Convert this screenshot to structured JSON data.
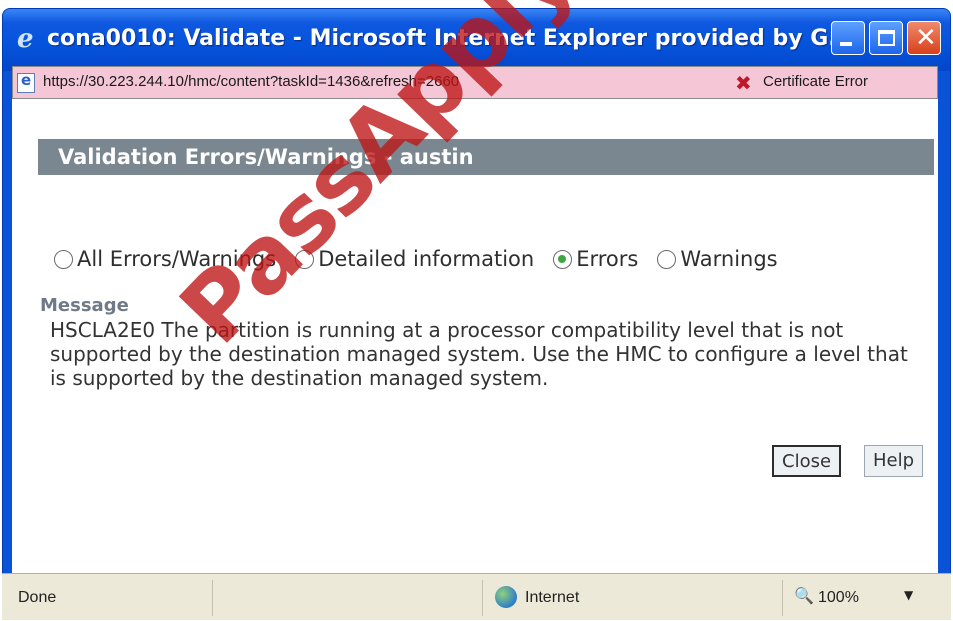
{
  "window": {
    "title": "cona0010: Validate - Microsoft Internet Explorer provided by G...",
    "icon": "ie-icon",
    "controls": [
      "minimize-icon",
      "maximize-icon",
      "close-icon"
    ]
  },
  "address_bar": {
    "url": "https://30.223.244.10/hmc/content?taskId=1436&refresh=2660",
    "certificate_error": "Certificate Error"
  },
  "dialog": {
    "header": "Validation Errors/Warnings - austin",
    "filters": [
      {
        "label": "All Errors/Warnings",
        "selected": false
      },
      {
        "label": "Detailed information",
        "selected": false
      },
      {
        "label": "Errors",
        "selected": true
      },
      {
        "label": "Warnings",
        "selected": false
      }
    ],
    "message_label": "Message",
    "message_text": "HSCLA2E0 The partition is running at a processor compatibility level that is not supported by the destination managed system. Use the HMC to configure a level that is supported by the destination managed system.",
    "buttons": {
      "close": "Close",
      "help": "Help"
    }
  },
  "status_bar": {
    "status": "Done",
    "zone": "Internet",
    "zoom": "100%"
  },
  "watermark": "PassApply.com",
  "colors": {
    "titlebar": "#0553db",
    "header_band": "#7a8790",
    "address_bar": "#f5c7d6",
    "watermark": "#be1414"
  }
}
